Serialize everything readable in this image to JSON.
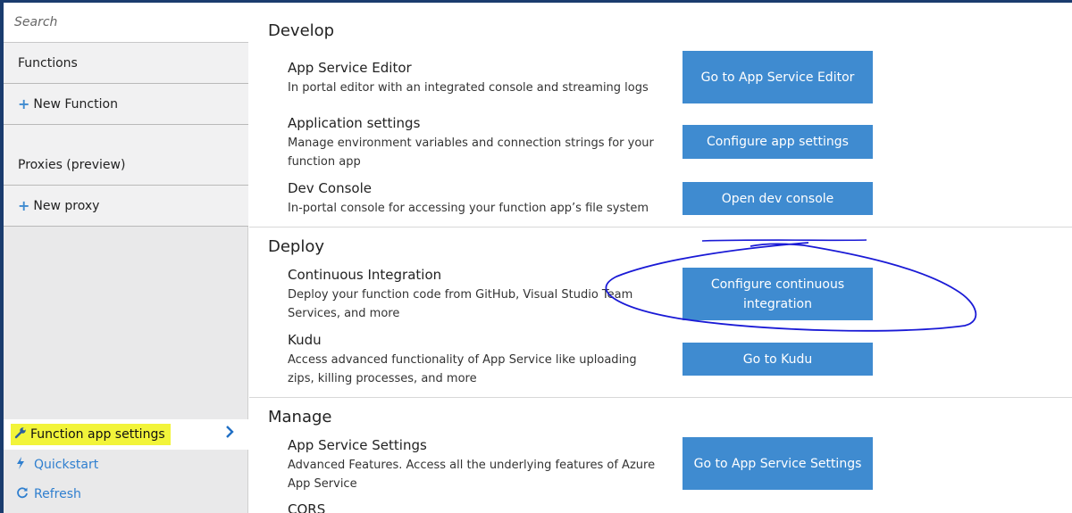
{
  "sidebar": {
    "search_placeholder": "Search",
    "functions_label": "Functions",
    "new_function_label": "New Function",
    "proxies_label": "Proxies (preview)",
    "new_proxy_label": "New proxy",
    "function_app_settings_label": "Function app settings",
    "quickstart_label": "Quickstart",
    "refresh_label": "Refresh"
  },
  "main": {
    "develop": {
      "title": "Develop",
      "items": [
        {
          "title": "App Service Editor",
          "desc": "In portal editor with an integrated console and streaming logs",
          "button": "Go to App Service Editor"
        },
        {
          "title": "Application settings",
          "desc": "Manage environment variables and connection strings for your function app",
          "button": "Configure app settings"
        },
        {
          "title": "Dev Console",
          "desc": "In-portal console for accessing your function app’s file system",
          "button": "Open dev console"
        }
      ]
    },
    "deploy": {
      "title": "Deploy",
      "items": [
        {
          "title": "Continuous Integration",
          "desc": "Deploy your function code from GitHub, Visual Studio Team Services, and more",
          "button": "Configure continuous integration"
        },
        {
          "title": "Kudu",
          "desc": "Access advanced functionality of App Service like uploading zips, killing processes, and more",
          "button": "Go to Kudu"
        }
      ]
    },
    "manage": {
      "title": "Manage",
      "items": [
        {
          "title": "App Service Settings",
          "desc": "Advanced Features. Access all the underlying features of Azure App Service",
          "button": "Go to App Service Settings"
        },
        {
          "title": "CORS"
        }
      ]
    }
  },
  "colors": {
    "accent_button": "#3f8bd0",
    "highlight": "#f2f43a",
    "annotation_ink": "#1a1ad6"
  },
  "icons": [
    "plus-icon",
    "wrench-icon",
    "chevron-right-icon",
    "lightning-icon",
    "refresh-icon"
  ]
}
